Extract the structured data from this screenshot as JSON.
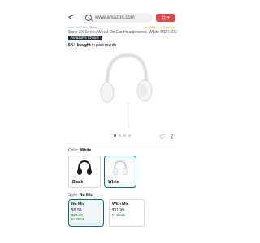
{
  "browser": {
    "url": "www.amazon.com",
    "open_app_label": "打开"
  },
  "product": {
    "store_link": "Visit the Sony Store",
    "rating_text": "★★★★☆ 4.5 ratings",
    "title": "Sony ZX Series Wired On-Ear Headphones, White MDR-ZX110",
    "badge": "Amazon's Choice",
    "bought_bold": "5K+ bought",
    "bought_rest": " in past month"
  },
  "color": {
    "label": "Color:",
    "selected": "White",
    "options": [
      {
        "name": "Black",
        "swatch": "#1a1a1a"
      },
      {
        "name": "White",
        "swatch": "#f2f2f2"
      }
    ]
  },
  "style": {
    "label": "Style:",
    "selected": "No Mic",
    "options": [
      {
        "name": "No Mic",
        "price": "$9.99",
        "list_price": "$24.99",
        "stock": "In Stock"
      },
      {
        "name": "With Mic",
        "price": "$11.99",
        "list_price": "",
        "stock": "In Stock"
      }
    ]
  },
  "colors": {
    "accent": "#007185",
    "badge_bg": "#232f3e",
    "in_stock": "#007600",
    "open_btn": "#e0464b"
  }
}
